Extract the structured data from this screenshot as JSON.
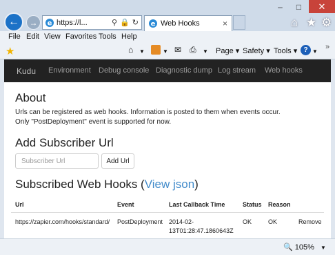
{
  "browser": {
    "address_text": "https://l...",
    "tab_title": "Web Hooks",
    "tab_close": "×",
    "window_buttons": {
      "minimize": "–",
      "maximize": "□",
      "close": "✕"
    }
  },
  "menu": {
    "file": "File",
    "edit": "Edit",
    "view": "View",
    "favorites": "Favorites",
    "tools": "Tools",
    "help": "Help"
  },
  "commandbar": {
    "page": "Page ▾",
    "safety": "Safety ▾",
    "tools": "Tools ▾",
    "help_icon": "?",
    "expand": "»"
  },
  "nav": {
    "brand": "Kudu",
    "items": [
      "Environment",
      "Debug console",
      "Diagnostic dump",
      "Log stream",
      "Web hooks"
    ]
  },
  "about": {
    "heading": "About",
    "line1": "Urls can be registered as web hooks. Information is posted to them when events occur.",
    "line2": "Only \"PostDeployment\" event is supported for now."
  },
  "add": {
    "heading": "Add Subscriber Url",
    "placeholder": "Subscriber Url",
    "button": "Add Url"
  },
  "subscribed": {
    "heading": "Subscribed Web Hooks (",
    "link": "View json",
    "heading_end": ")"
  },
  "table": {
    "headers": [
      "Url",
      "Event",
      "Last Callback Time",
      "Status",
      "Reason"
    ],
    "rows": [
      {
        "url": "https://zapier.com/hooks/standard/",
        "event": "PostDeployment",
        "time_line1": "2014-02-",
        "time_line2": "13T01:28:47.1860643Z",
        "status": "OK",
        "reason": "OK",
        "action": "Remove"
      }
    ]
  },
  "status": {
    "zoom": "105%"
  },
  "colors": {
    "navbar": "#222222",
    "link": "#428bca",
    "close_button": "#c8433a",
    "back_button": "#1c72c7"
  }
}
